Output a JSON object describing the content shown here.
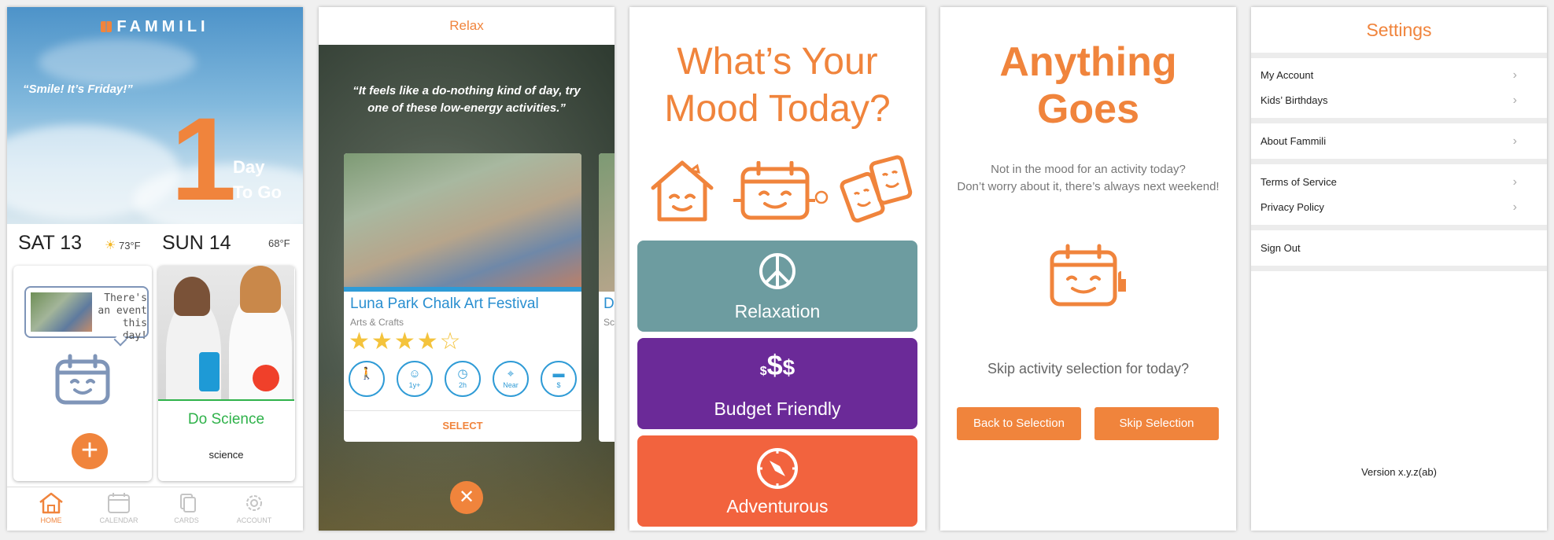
{
  "screen1": {
    "logo": "FAMMILI",
    "quote": "“Smile! It’s Friday!”",
    "countdown_number": "1",
    "countdown_line1": "Day",
    "countdown_line2": "To Go",
    "sat": {
      "label": "SAT 13",
      "temp": "73°F",
      "weather_icon": "sun-icon"
    },
    "sun": {
      "label": "SUN 14",
      "temp": "68°F"
    },
    "event_bubble_text": "There's an event this day!",
    "science_card": {
      "title": "Do Science",
      "subtitle": "science"
    },
    "tabs": [
      {
        "label": "HOME",
        "icon": "home-icon",
        "active": true
      },
      {
        "label": "CALENDAR",
        "icon": "calendar-icon"
      },
      {
        "label": "CARDS",
        "icon": "cards-icon"
      },
      {
        "label": "ACCOUNT",
        "icon": "gear-icon"
      }
    ]
  },
  "screen2": {
    "header": "Relax",
    "quote": "“It feels like a do-nothing kind of day, try one of these low-energy activities.”",
    "event": {
      "title": "Luna Park Chalk Art Festival",
      "category": "Arts & Crafts",
      "rating": 4,
      "rating_max": 5,
      "icon_labels": [
        "",
        "1y+",
        "2h",
        "Near",
        "$"
      ]
    },
    "peek_title": "D",
    "peek_sub": "Sc",
    "select": "SELECT"
  },
  "screen3": {
    "title_line1": "What’s Your",
    "title_line2": "Mood Today?",
    "buttons": [
      {
        "label": "Relaxation",
        "color": "#6d9ca0",
        "icon": "peace-icon"
      },
      {
        "label": "Budget Friendly",
        "color": "#6b2a98",
        "icon": "dollars-icon"
      },
      {
        "label": "Adventurous",
        "color": "#f2633e",
        "icon": "compass-icon"
      }
    ]
  },
  "screen4": {
    "title_line1": "Anything",
    "title_line2": "Goes",
    "message_line1": "Not in the mood for an activity today?",
    "message_line2": "Don’t worry about it, there’s always next weekend!",
    "skip_question": "Skip activity selection for today?",
    "back_button": "Back to Selection",
    "skip_button": "Skip Selection"
  },
  "screen5": {
    "title": "Settings",
    "items": [
      "My Account",
      "Kids’ Birthdays",
      "About Fammili",
      "Terms of Service",
      "Privacy Policy",
      "Sign Out"
    ],
    "version": "Version x.y.z(ab)"
  },
  "colors": {
    "accent": "#f0843c",
    "blue": "#2a8fd0",
    "green": "#2fb24a"
  }
}
